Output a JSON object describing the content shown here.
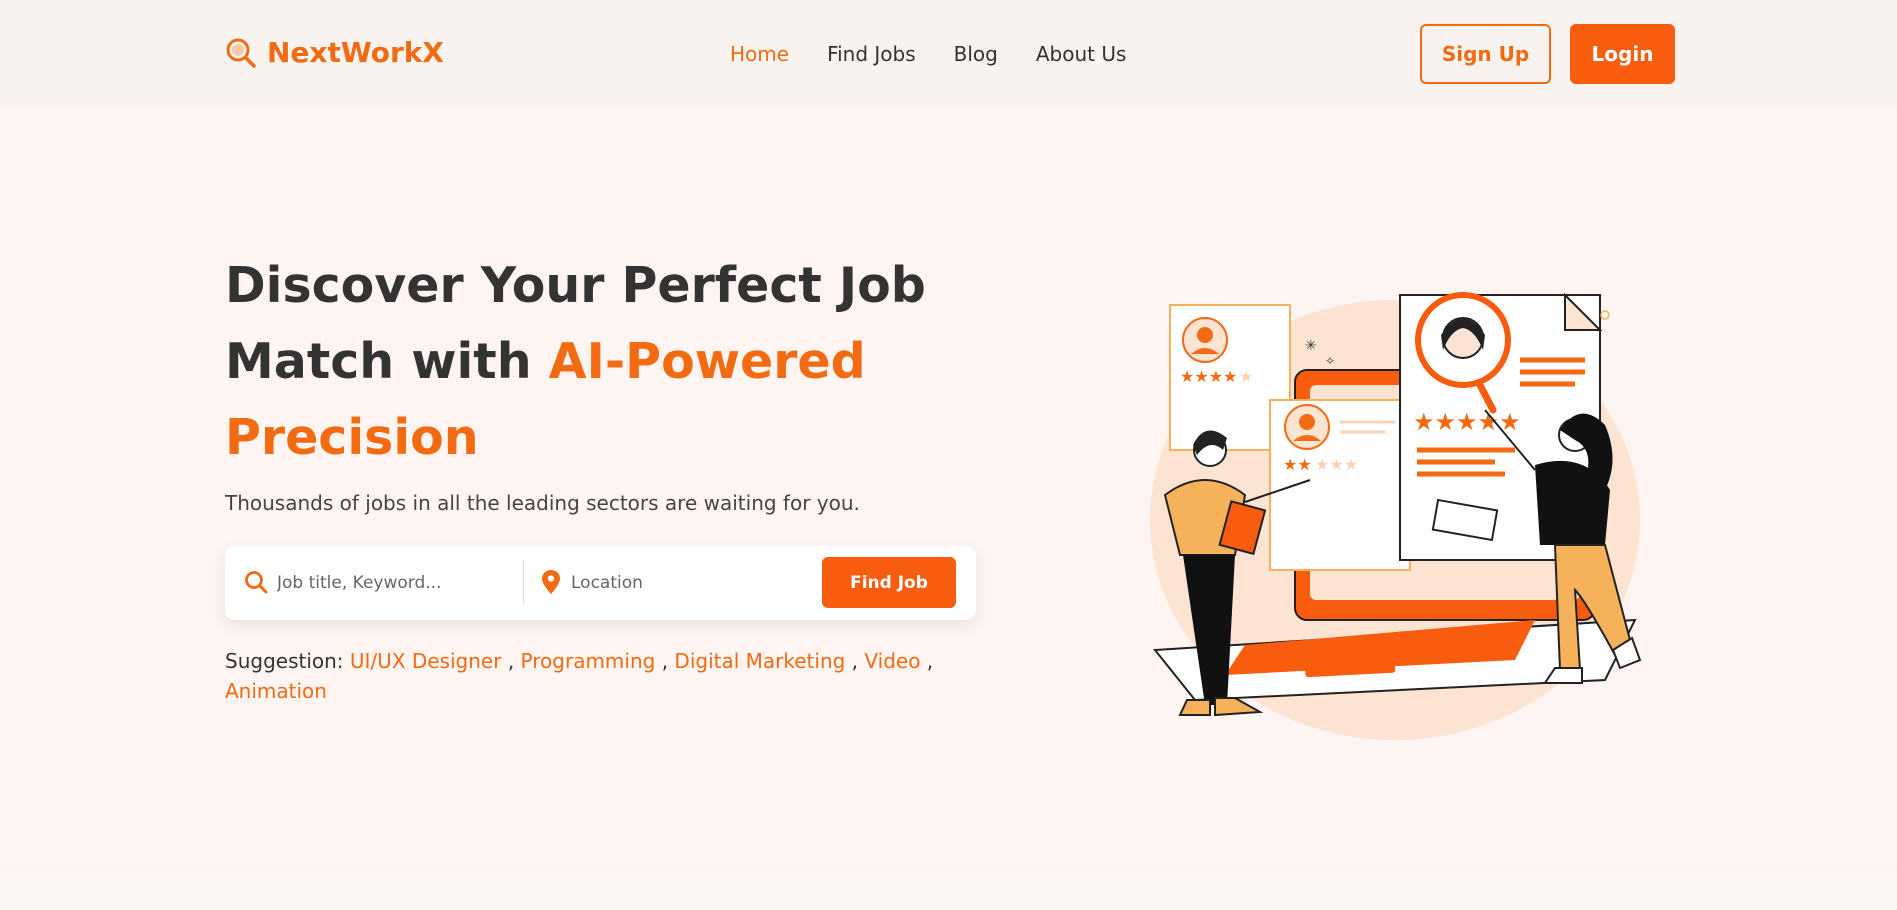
{
  "brand": {
    "name": "NextWorkX",
    "color": "#f26a12",
    "icon": "magnifier-logo-icon"
  },
  "nav": {
    "items": [
      {
        "label": "Home",
        "active": true
      },
      {
        "label": "Find Jobs",
        "active": false
      },
      {
        "label": "Blog",
        "active": false
      },
      {
        "label": "About Us",
        "active": false
      }
    ]
  },
  "auth": {
    "signup_label": "Sign Up",
    "login_label": "Login"
  },
  "hero": {
    "headline_part1": "Discover Your Perfect Job Match with ",
    "headline_accent": "AI-Powered Precision",
    "subtext": "Thousands of jobs in all the leading sectors are waiting for you."
  },
  "search": {
    "keyword_placeholder": "Job title, Keyword...",
    "location_placeholder": "Location",
    "button_label": "Find Job",
    "keyword_icon": "search-icon",
    "location_icon": "location-pin-icon"
  },
  "suggestions": {
    "label": "Suggestion:",
    "items": [
      "UI/UX Designer",
      "Programming",
      "Digital Marketing",
      "Video",
      "Animation"
    ]
  },
  "colors": {
    "accent": "#f26a12",
    "button": "#f85c0e",
    "text": "#333333",
    "background": "#fef5f2"
  }
}
